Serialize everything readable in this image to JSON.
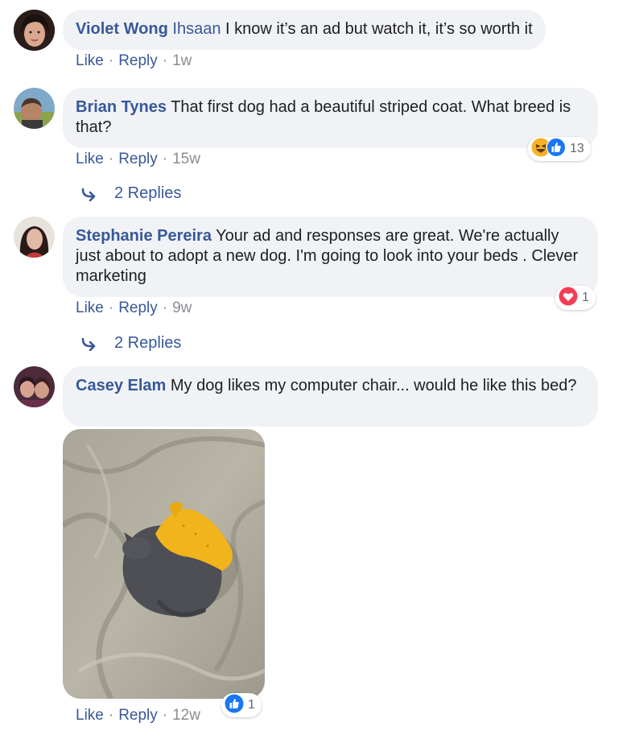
{
  "comments": [
    {
      "author": "Violet Wong",
      "mention": "Ihsaan",
      "text": "I know it’s an ad but watch it, it’s so worth it",
      "like": "Like",
      "reply": "Reply",
      "time": "1w"
    },
    {
      "author": "Brian Tynes",
      "text": "That first dog had a beautiful striped coat. What breed is that?",
      "like": "Like",
      "reply": "Reply",
      "time": "15w",
      "reactions": {
        "count": "13",
        "icons": [
          "haha-icon",
          "like-icon"
        ]
      },
      "replies_label": "2 Replies"
    },
    {
      "author": "Stephanie Pereira",
      "text": "Your ad and responses are great. We're actually just about to adopt a new dog. I'm going to look into your beds . Clever marketing",
      "like": "Like",
      "reply": "Reply",
      "time": "9w",
      "reactions": {
        "count": "1",
        "icons": [
          "love-icon"
        ]
      },
      "replies_label": "2 Replies"
    },
    {
      "author": "Casey Elam",
      "text": "My dog likes my computer chair... would he like this bed?",
      "like": "Like",
      "reply": "Reply",
      "time": "12w",
      "reactions": {
        "count": "1",
        "icons": [
          "like-icon"
        ]
      },
      "attachment": "photo"
    }
  ],
  "colors": {
    "link": "#385898",
    "bubble": "#f0f2f5",
    "meta": "#8a8d91",
    "like_blue": "#1877f2",
    "love_red": "#f33e58",
    "haha_yellow": "#f7b125"
  }
}
